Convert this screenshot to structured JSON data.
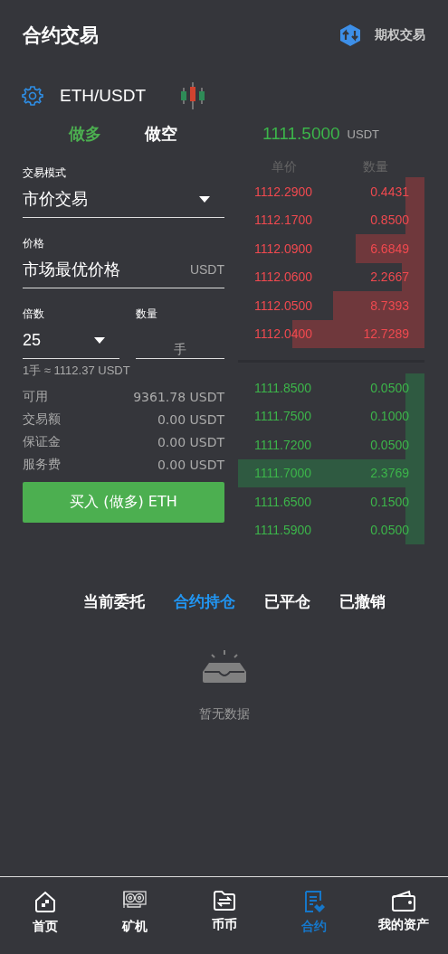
{
  "header": {
    "title": "合约交易",
    "option_link": "期权交易"
  },
  "pair": {
    "symbol": "ETH/USDT"
  },
  "side_tabs": [
    {
      "label": "做多",
      "selected": true
    },
    {
      "label": "做空",
      "selected": false
    }
  ],
  "last_price": {
    "value": "1111.5000",
    "unit": "USDT"
  },
  "form": {
    "mode_label": "交易模式",
    "mode_value": "市价交易",
    "price_label": "价格",
    "price_value": "市场最优价格",
    "price_unit": "USDT",
    "leverage_label": "倍数",
    "leverage_value": "25",
    "amount_label": "数量",
    "amount_unit": "手",
    "lot_note": "1手 ≈ 1112.37 USDT",
    "info": [
      {
        "label": "可用",
        "value": "9361.78 USDT"
      },
      {
        "label": "交易额",
        "value": "0.00 USDT"
      },
      {
        "label": "保证金",
        "value": "0.00 USDT"
      },
      {
        "label": "服务费",
        "value": "0.00 USDT"
      }
    ],
    "submit": "买入 (做多) ETH"
  },
  "order_book": {
    "columns": [
      "单价",
      "数量"
    ],
    "asks": [
      {
        "price": "1112.2900",
        "amount": "0.4431"
      },
      {
        "price": "1112.1700",
        "amount": "0.8500"
      },
      {
        "price": "1112.0900",
        "amount": "6.6849"
      },
      {
        "price": "1112.0600",
        "amount": "2.2667"
      },
      {
        "price": "1112.0500",
        "amount": "8.7393"
      },
      {
        "price": "1112.0400",
        "amount": "12.7289"
      }
    ],
    "bids": [
      {
        "price": "1111.8500",
        "amount": "0.0500"
      },
      {
        "price": "1111.7500",
        "amount": "0.1000"
      },
      {
        "price": "1111.7200",
        "amount": "0.0500"
      },
      {
        "price": "1111.7000",
        "amount": "2.3769"
      },
      {
        "price": "1111.6500",
        "amount": "0.1500"
      },
      {
        "price": "1111.5900",
        "amount": "0.0500"
      }
    ]
  },
  "order_tabs": [
    {
      "label": "当前委托",
      "selected": false
    },
    {
      "label": "合约持仓",
      "selected": true
    },
    {
      "label": "已平仓",
      "selected": false
    },
    {
      "label": "已撤销",
      "selected": false
    }
  ],
  "empty_state": "暂无数据",
  "bottom_nav": [
    {
      "kind": "home",
      "label": "首页",
      "selected": false
    },
    {
      "kind": "miner",
      "label": "矿机",
      "selected": false
    },
    {
      "kind": "exchange",
      "label": "币币",
      "selected": false
    },
    {
      "kind": "contract",
      "label": "合约",
      "selected": true
    },
    {
      "kind": "wallet",
      "label": "我的资产",
      "selected": false
    }
  ]
}
